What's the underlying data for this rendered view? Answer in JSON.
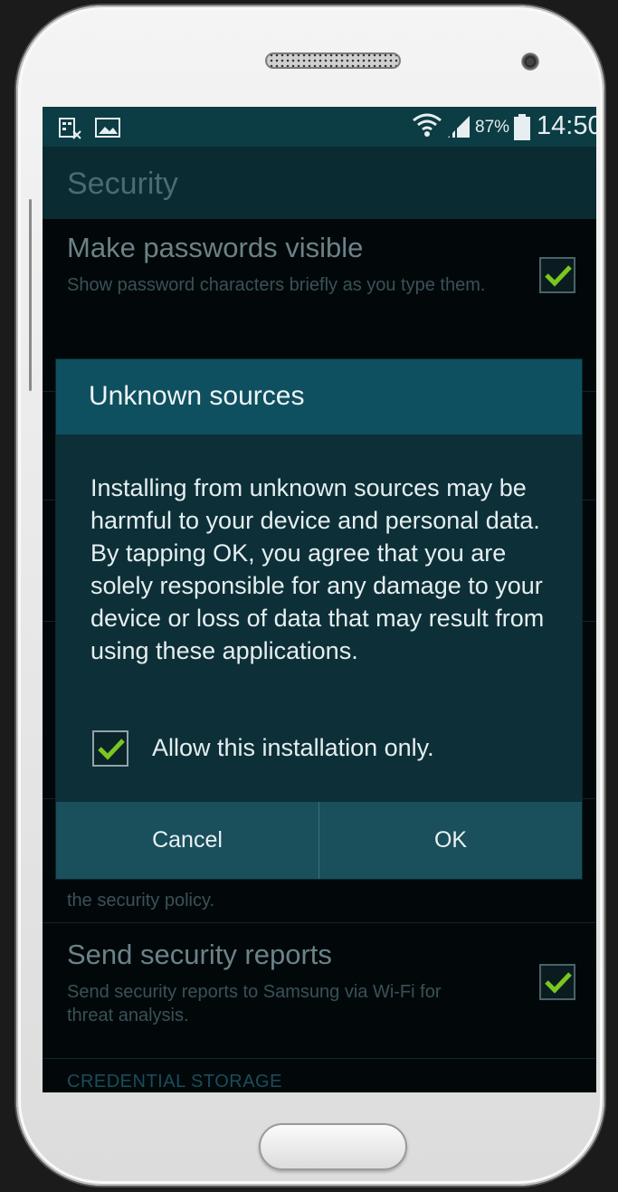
{
  "status_bar": {
    "left_icons": [
      "screen-mirroring-icon",
      "image-icon"
    ],
    "right_icons": [
      "wifi-icon",
      "signal-icon",
      "battery-icon"
    ],
    "battery_percent": "87%",
    "time": "14:50"
  },
  "action_bar": {
    "title": "Security"
  },
  "settings": {
    "items": [
      {
        "title": "Make passwords visible",
        "summary": "Show password characters briefly as you type them.",
        "checked": true
      },
      {
        "title": "",
        "summary": "the security policy."
      },
      {
        "title": "Send security reports",
        "summary": "Send security reports to Samsung via Wi-Fi for threat analysis.",
        "checked": true
      }
    ],
    "section_header": "CREDENTIAL STORAGE"
  },
  "dialog": {
    "title": "Unknown sources",
    "message": "Installing from unknown sources may be harmful to your device and personal data. By tapping OK, you agree that you are solely responsible for any damage to your device or loss of data that may result from using these applications.",
    "option_label": "Allow this installation only.",
    "option_checked": true,
    "cancel_label": "Cancel",
    "ok_label": "OK"
  },
  "colors": {
    "check_green": "#7bc61f",
    "dialog_header": "#0e5060",
    "status_bar": "#0c3c44"
  }
}
